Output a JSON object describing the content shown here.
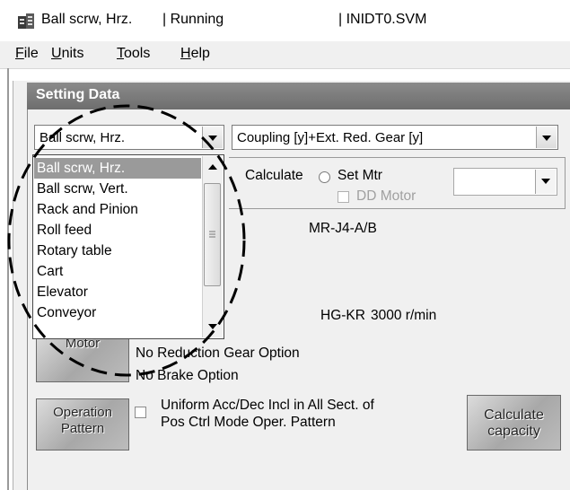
{
  "window": {
    "title_app": "Ball scrw, Hrz.",
    "title_status": "| Running",
    "title_file": "| INIDT0.SVM"
  },
  "menu": {
    "items": [
      {
        "mnemonic": "F",
        "rest": "ile"
      },
      {
        "mnemonic": "U",
        "rest": "nits"
      },
      {
        "mnemonic": "T",
        "rest": "ools"
      },
      {
        "mnemonic": "H",
        "rest": "elp"
      }
    ]
  },
  "panel": {
    "header": "Setting Data"
  },
  "mechanism_select": {
    "value": "Ball scrw, Hrz.",
    "options": [
      "Ball scrw, Hrz.",
      "Ball scrw, Vert.",
      "Rack and Pinion",
      "Roll feed",
      "Rotary table",
      "Cart",
      "Elevator",
      "Conveyor"
    ],
    "selected_index": 0
  },
  "coupling_select": {
    "value": "Coupling [y]+Ext. Red. Gear [y]"
  },
  "motor_mode": {
    "calculate_label": "Calculate",
    "set_motor_label": "Set Mtr",
    "dd_motor_label": "DD Motor"
  },
  "amplifier": {
    "model": "MR-J4-A/B"
  },
  "motor": {
    "button_label": "Motor",
    "series": "HG-KR",
    "speed": "3000 r/min",
    "gear_option": "No Reduction Gear Option",
    "brake_option": "No Brake Option"
  },
  "operation": {
    "button_label_line1": "Operation",
    "button_label_line2": "Pattern",
    "uniform_label_line1": "Uniform Acc/Dec Incl in All Sect. of",
    "uniform_label_line2": "Pos Ctrl Mode Oper. Pattern"
  },
  "calc_capacity": {
    "label_line1": "Calculate",
    "label_line2": "capacity"
  },
  "colors": {
    "header_bg": "#7a7a7a",
    "selected_item_bg": "#9a9a9a",
    "annotation": "#000000"
  }
}
